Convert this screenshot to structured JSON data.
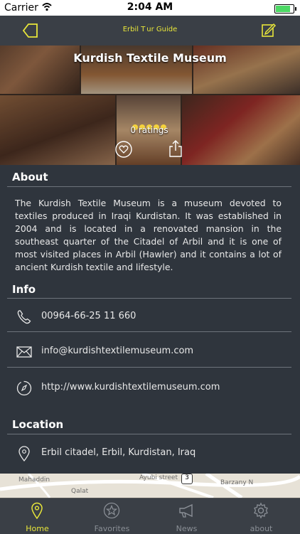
{
  "status_bar": {
    "carrier": "Carrier",
    "time": "2:04 AM",
    "battery_level": 0.85
  },
  "nav": {
    "app_title": "Erbil T ur Guide"
  },
  "place": {
    "title": "Kurdish Textile Museum",
    "rating_count": "0 ratings",
    "stars": 5
  },
  "about": {
    "heading": "About",
    "text": "The Kurdish Textile Museum is a museum devoted to textiles produced in Iraqi Kurdistan. It was established in 2004 and is located in a renovated mansion in the southeast quarter of the Citadel of Arbil and it is one of most visited places in Arbil (Hawler) and it contains a lot of ancient Kurdish textile and lifestyle."
  },
  "info": {
    "heading": "Info",
    "phone": "00964-66-25 11 660",
    "email": "info@kurdishtextilemuseum.com",
    "website": "http://www.kurdishtextilemuseum.com"
  },
  "location": {
    "heading": "Location",
    "address": "Erbil citadel, Erbil, Kurdistan, Iraq"
  },
  "map": {
    "street_1": "Ayubi street",
    "street_2": "Qalat",
    "street_3": "Barzany N",
    "street_4": "Mahaddin",
    "badge": "3"
  },
  "tabs": [
    {
      "label": "Home",
      "icon": "map-pin-icon",
      "active": true
    },
    {
      "label": "Favorites",
      "icon": "star-icon",
      "active": false
    },
    {
      "label": "News",
      "icon": "megaphone-icon",
      "active": false
    },
    {
      "label": "about",
      "icon": "gear-icon",
      "active": false
    }
  ],
  "colors": {
    "accent": "#e8e63a",
    "background": "#2f353d",
    "star": "#f5d33c"
  }
}
